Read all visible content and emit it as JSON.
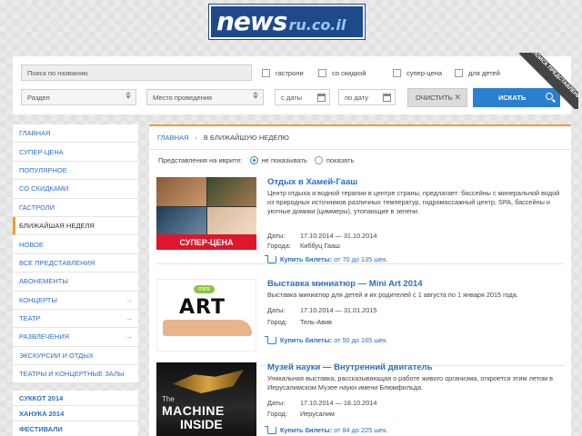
{
  "logo": {
    "main": "news",
    "domain": "ru.co.il"
  },
  "search": {
    "placeholder": "Поиск по названию",
    "checkboxes": [
      "гастроли",
      "со скидкой",
      "супер-цена",
      "для детей"
    ],
    "section": "Раздел",
    "venue": "Место проведения",
    "date_from": "с даты",
    "date_to": "по дату",
    "clear": "ОЧИСТИТЬ",
    "submit": "ИСКАТЬ",
    "ribbon": "ПОИСК ПРЕДСТАВЛЕНИЯ:"
  },
  "sidebar": {
    "items": [
      {
        "label": "ГЛАВНАЯ",
        "arrow": false,
        "active": false
      },
      {
        "label": "СУПЕР-ЦЕНА",
        "arrow": false,
        "active": false
      },
      {
        "label": "ПОПУЛЯРНОЕ",
        "arrow": false,
        "active": false
      },
      {
        "label": "СО СКИДКАМИ",
        "arrow": false,
        "active": false
      },
      {
        "label": "ГАСТРОЛИ",
        "arrow": false,
        "active": false
      },
      {
        "label": "БЛИЖАЙШАЯ НЕДЕЛЯ",
        "arrow": false,
        "active": true
      },
      {
        "label": "НОВОЕ",
        "arrow": false,
        "active": false
      },
      {
        "label": "ВСЕ ПРЕДСТАВЛЕНИЯ",
        "arrow": false,
        "active": false
      },
      {
        "label": "АБОНЕМЕНТЫ",
        "arrow": false,
        "active": false
      },
      {
        "label": "КОНЦЕРТЫ",
        "arrow": true,
        "active": false
      },
      {
        "label": "ТЕАТР",
        "arrow": true,
        "active": false
      },
      {
        "label": "РАЗВЛЕЧЕНИЯ",
        "arrow": true,
        "active": false
      },
      {
        "label": "ЭКСКУРСИИ И ОТДЫХ",
        "arrow": false,
        "active": false
      },
      {
        "label": "ТЕАТРЫ И КОНЦЕРТНЫЕ ЗАЛЫ",
        "arrow": false,
        "active": false
      }
    ],
    "arrow_glyph": "→",
    "specials": [
      "СУККОТ 2014",
      "ХАНУКА 2014",
      "ФЕСТИВАЛИ"
    ]
  },
  "breadcrumb": {
    "home": "ГЛАВНАЯ",
    "sep": "›",
    "current": "В БЛИЖАЙШУЮ НЕДЕЛЮ"
  },
  "filter": {
    "label": "Представления на иврите:",
    "opt_hide": "не показывать",
    "opt_show": "показать"
  },
  "events": [
    {
      "title": "Отдых в Хамей-Гааш",
      "desc": "Центр отдыха и водной терапии в центре страны, предлагает: бассейны с минеральной водой из природных источников различных температур, гидромассажный центр, SPA, бассейны и уютные домики (циммеры), утопающие в зелени.",
      "dates_label": "Даты:",
      "dates": "17.10.2014 — 31.10.2014",
      "city_label": "Города:",
      "city": "Киббуц Гааш",
      "tickets_label": "Купить билеты:",
      "tickets_price": "от 70 до 135 шек.",
      "badge": "СУПЕР-ЦЕНА"
    },
    {
      "title": "Выставка миниатюр — Mini Art 2014",
      "desc": "Выставка миниатюр для детей и их родителей с 1 августа по 1 января 2015 года.",
      "dates_label": "Даты:",
      "dates": "17.10.2014 — 31.01.2015",
      "city_label": "Город:",
      "city": "Тель-Авив",
      "tickets_label": "Купить билеты:",
      "tickets_price": "от 50 до 165 шек.",
      "img_mini": "mini",
      "img_art": "ART"
    },
    {
      "title": "Музей науки — Внутренний двигатель",
      "desc": "Уникальная выставка, рассказывающая о работе живого организма, откроется этим летом в Иерусалимском Музее науки имени Блюмфильда.",
      "dates_label": "Даты:",
      "dates": "17.10.2014 — 18.10.2014",
      "city_label": "Город:",
      "city": "Иерусалим",
      "tickets_label": "Купить билеты:",
      "tickets_price": "от 84 до 225 шек.",
      "img_the": "The",
      "img_machine": "MACHINE",
      "img_inside": "INSIDE"
    }
  ]
}
